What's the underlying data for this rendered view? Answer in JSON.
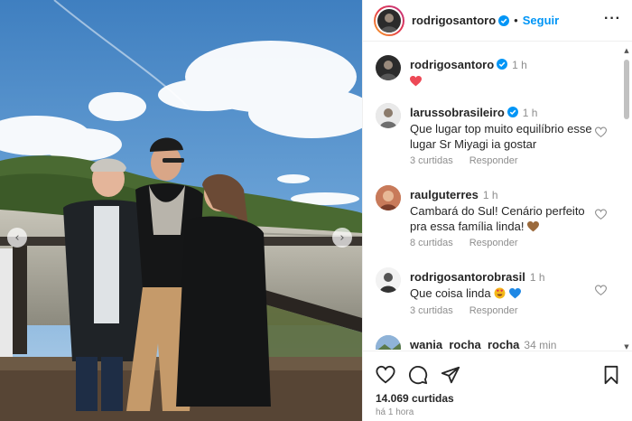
{
  "post": {
    "author": "rodrigosantoro",
    "follow_label": "Seguir",
    "separator": "•",
    "more_label": "···"
  },
  "caption": {
    "username": "rodrigosantoro",
    "time": "1 h",
    "text": "❤️"
  },
  "comments": [
    {
      "username": "larussobrasileiro",
      "verified": true,
      "time": "1 h",
      "text": "Que lugar top muito equilíbrio esse lugar Sr Miyagi ia gostar",
      "likes": "3 curtidas",
      "reply": "Responder"
    },
    {
      "username": "raulguterres",
      "verified": false,
      "time": "1 h",
      "text": "Cambará do Sul! Cenário perfeito pra essa família linda!",
      "likes": "8 curtidas",
      "reply": "Responder"
    },
    {
      "username": "rodrigosantorobrasil",
      "verified": false,
      "time": "1 h",
      "text": "Que coisa linda",
      "likes": "3 curtidas",
      "reply": "Responder"
    },
    {
      "username": "wania_rocha_rocha",
      "verified": false,
      "time": "34 min"
    }
  ],
  "footer": {
    "likes_count": "14.069 curtidas",
    "posted_ago": "há 1 hora"
  },
  "colors": {
    "accent": "#0095f6",
    "verified": "#0095f6",
    "heart": "#ed4956",
    "muted": "#8e8e8e"
  },
  "icons": {
    "like": "heart-icon",
    "comment": "comment-icon",
    "share": "share-icon",
    "save": "bookmark-icon"
  }
}
